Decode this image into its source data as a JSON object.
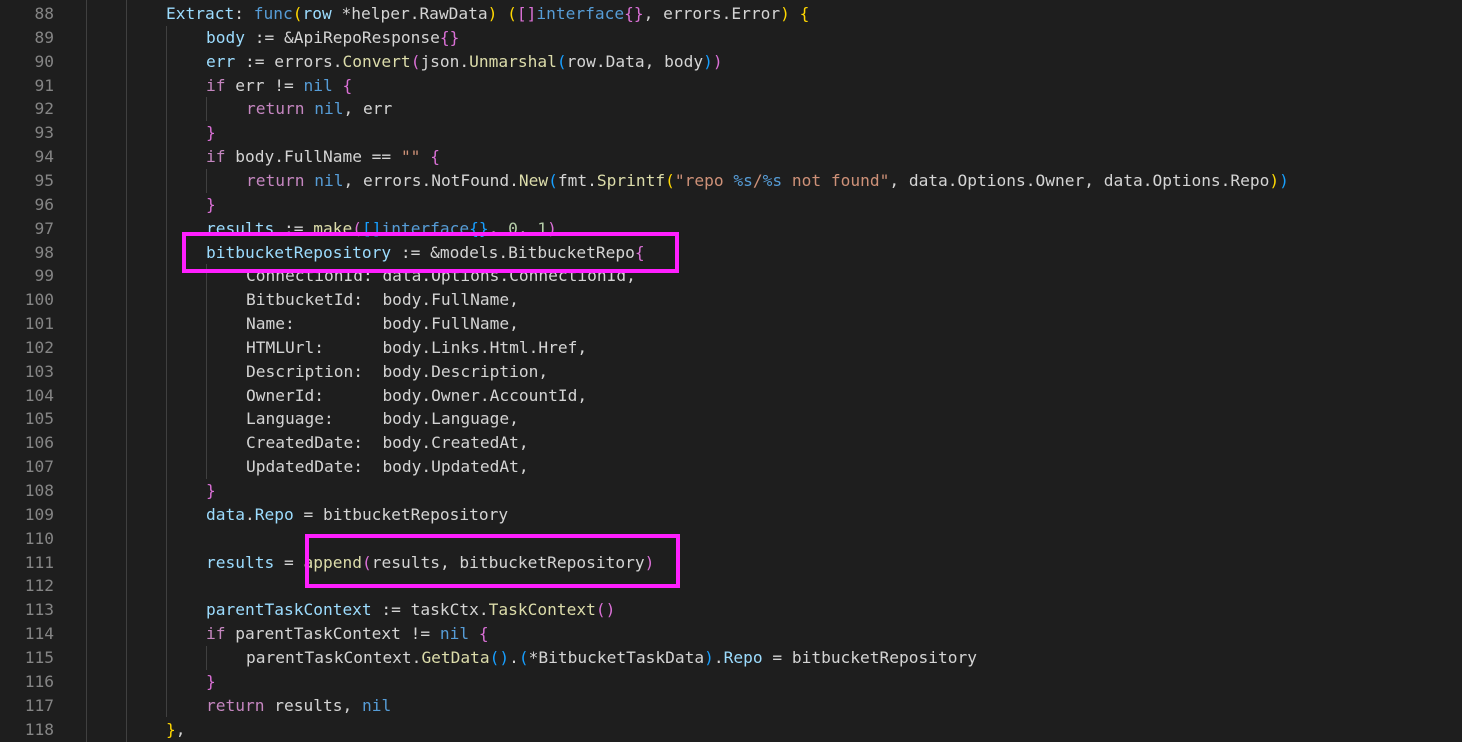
{
  "editor": {
    "language": "go",
    "colors": {
      "background": "#1e1e1e",
      "line_number": "#858585",
      "highlight": "#ff1fff"
    },
    "lines": [
      {
        "number": "88",
        "tokens": [
          [
            "tk-var",
            "Extract"
          ],
          [
            "tk-plain",
            ": "
          ],
          [
            "tk-kw",
            "func"
          ],
          [
            "tk-b1",
            "("
          ],
          [
            "tk-var",
            "row"
          ],
          [
            "tk-plain",
            " *"
          ],
          [
            "tk-plain",
            "helper.RawData"
          ],
          [
            "tk-b1",
            ")"
          ],
          [
            "tk-plain",
            " "
          ],
          [
            "tk-b1",
            "("
          ],
          [
            "tk-b2",
            "[]"
          ],
          [
            "tk-kw",
            "interface"
          ],
          [
            "tk-b2",
            "{}"
          ],
          [
            "tk-plain",
            ", errors.Error"
          ],
          [
            "tk-b1",
            ")"
          ],
          [
            "tk-plain",
            " "
          ],
          [
            "tk-b1",
            "{"
          ]
        ]
      },
      {
        "number": "89",
        "tokens": [
          [
            "tk-var",
            "body"
          ],
          [
            "tk-plain",
            " := &ApiRepoResponse"
          ],
          [
            "tk-b2",
            "{}"
          ]
        ]
      },
      {
        "number": "90",
        "tokens": [
          [
            "tk-var",
            "err"
          ],
          [
            "tk-plain",
            " := errors."
          ],
          [
            "tk-fn",
            "Convert"
          ],
          [
            "tk-b2",
            "("
          ],
          [
            "tk-plain",
            "json."
          ],
          [
            "tk-fn",
            "Unmarshal"
          ],
          [
            "tk-b3",
            "("
          ],
          [
            "tk-plain",
            "row.Data, body"
          ],
          [
            "tk-b3",
            ")"
          ],
          [
            "tk-b2",
            ")"
          ]
        ]
      },
      {
        "number": "91",
        "tokens": [
          [
            "tk-ctrl",
            "if"
          ],
          [
            "tk-plain",
            " err != "
          ],
          [
            "tk-kw",
            "nil"
          ],
          [
            "tk-plain",
            " "
          ],
          [
            "tk-b2",
            "{"
          ]
        ]
      },
      {
        "number": "92",
        "tokens": [
          [
            "tk-ctrl",
            "return"
          ],
          [
            "tk-plain",
            " "
          ],
          [
            "tk-kw",
            "nil"
          ],
          [
            "tk-plain",
            ", err"
          ]
        ]
      },
      {
        "number": "93",
        "tokens": [
          [
            "tk-b2",
            "}"
          ]
        ]
      },
      {
        "number": "94",
        "tokens": [
          [
            "tk-ctrl",
            "if"
          ],
          [
            "tk-plain",
            " body.FullName == "
          ],
          [
            "tk-str",
            "\"\""
          ],
          [
            "tk-plain",
            " "
          ],
          [
            "tk-b2",
            "{"
          ]
        ]
      },
      {
        "number": "95",
        "tokens": [
          [
            "tk-ctrl",
            "return"
          ],
          [
            "tk-plain",
            " "
          ],
          [
            "tk-kw",
            "nil"
          ],
          [
            "tk-plain",
            ", errors.NotFound."
          ],
          [
            "tk-fn",
            "New"
          ],
          [
            "tk-b3",
            "("
          ],
          [
            "tk-plain",
            "fmt."
          ],
          [
            "tk-fn",
            "Sprintf"
          ],
          [
            "tk-b1",
            "("
          ],
          [
            "tk-str",
            "\"repo "
          ],
          [
            "tk-kw",
            "%s"
          ],
          [
            "tk-str",
            "/"
          ],
          [
            "tk-kw",
            "%s"
          ],
          [
            "tk-str",
            " not found\""
          ],
          [
            "tk-plain",
            ", data.Options.Owner, data.Options.Repo"
          ],
          [
            "tk-b1",
            ")"
          ],
          [
            "tk-b3",
            ")"
          ]
        ]
      },
      {
        "number": "96",
        "tokens": [
          [
            "tk-b2",
            "}"
          ]
        ]
      },
      {
        "number": "97",
        "tokens": [
          [
            "tk-var",
            "results"
          ],
          [
            "tk-plain",
            " := "
          ],
          [
            "tk-fn",
            "make"
          ],
          [
            "tk-b2",
            "("
          ],
          [
            "tk-b3",
            "[]"
          ],
          [
            "tk-kw",
            "interface"
          ],
          [
            "tk-b3",
            "{}"
          ],
          [
            "tk-plain",
            ", "
          ],
          [
            "tk-num",
            "0"
          ],
          [
            "tk-plain",
            ", "
          ],
          [
            "tk-num",
            "1"
          ],
          [
            "tk-b2",
            ")"
          ]
        ]
      },
      {
        "number": "98",
        "tokens": [
          [
            "tk-var",
            "bitbucketRepository"
          ],
          [
            "tk-plain",
            " := &models.BitbucketRepo"
          ],
          [
            "tk-b2",
            "{"
          ]
        ]
      },
      {
        "number": "99",
        "tokens": [
          [
            "tk-plain",
            "ConnectionId: data.Options.ConnectionId,"
          ]
        ]
      },
      {
        "number": "100",
        "tokens": [
          [
            "tk-plain",
            "BitbucketId:  body.FullName,"
          ]
        ]
      },
      {
        "number": "101",
        "tokens": [
          [
            "tk-plain",
            "Name:         body.FullName,"
          ]
        ]
      },
      {
        "number": "102",
        "tokens": [
          [
            "tk-plain",
            "HTMLUrl:      body.Links.Html.Href,"
          ]
        ]
      },
      {
        "number": "103",
        "tokens": [
          [
            "tk-plain",
            "Description:  body.Description,"
          ]
        ]
      },
      {
        "number": "104",
        "tokens": [
          [
            "tk-plain",
            "OwnerId:      body.Owner.AccountId,"
          ]
        ]
      },
      {
        "number": "105",
        "tokens": [
          [
            "tk-plain",
            "Language:     body.Language,"
          ]
        ]
      },
      {
        "number": "106",
        "tokens": [
          [
            "tk-plain",
            "CreatedDate:  body.CreatedAt,"
          ]
        ]
      },
      {
        "number": "107",
        "tokens": [
          [
            "tk-plain",
            "UpdatedDate:  body.UpdatedAt,"
          ]
        ]
      },
      {
        "number": "108",
        "tokens": [
          [
            "tk-b2",
            "}"
          ]
        ]
      },
      {
        "number": "109",
        "tokens": [
          [
            "tk-var",
            "data"
          ],
          [
            "tk-plain",
            "."
          ],
          [
            "tk-var",
            "Repo"
          ],
          [
            "tk-plain",
            " = bitbucketRepository"
          ]
        ]
      },
      {
        "number": "110",
        "tokens": []
      },
      {
        "number": "111",
        "tokens": [
          [
            "tk-var",
            "results"
          ],
          [
            "tk-plain",
            " = "
          ],
          [
            "tk-fn",
            "append"
          ],
          [
            "tk-b2",
            "("
          ],
          [
            "tk-plain",
            "results, bitbucketRepository"
          ],
          [
            "tk-b2",
            ")"
          ]
        ]
      },
      {
        "number": "112",
        "tokens": []
      },
      {
        "number": "113",
        "tokens": [
          [
            "tk-var",
            "parentTaskContext"
          ],
          [
            "tk-plain",
            " := taskCtx."
          ],
          [
            "tk-fn",
            "TaskContext"
          ],
          [
            "tk-b2",
            "()"
          ]
        ]
      },
      {
        "number": "114",
        "tokens": [
          [
            "tk-ctrl",
            "if"
          ],
          [
            "tk-plain",
            " parentTaskContext != "
          ],
          [
            "tk-kw",
            "nil"
          ],
          [
            "tk-plain",
            " "
          ],
          [
            "tk-b2",
            "{"
          ]
        ]
      },
      {
        "number": "115",
        "tokens": [
          [
            "tk-plain",
            "parentTaskContext."
          ],
          [
            "tk-fn",
            "GetData"
          ],
          [
            "tk-b3",
            "()"
          ],
          [
            "tk-plain",
            "."
          ],
          [
            "tk-b3",
            "("
          ],
          [
            "tk-plain",
            "*BitbucketTaskData"
          ],
          [
            "tk-b3",
            ")"
          ],
          [
            "tk-plain",
            "."
          ],
          [
            "tk-var",
            "Repo"
          ],
          [
            "tk-plain",
            " = bitbucketRepository"
          ]
        ]
      },
      {
        "number": "116",
        "tokens": [
          [
            "tk-b2",
            "}"
          ]
        ]
      },
      {
        "number": "117",
        "tokens": [
          [
            "tk-ctrl",
            "return"
          ],
          [
            "tk-plain",
            " results, "
          ],
          [
            "tk-kw",
            "nil"
          ]
        ]
      },
      {
        "number": "118",
        "tokens": [
          [
            "tk-b1",
            "}"
          ],
          [
            "tk-plain",
            ","
          ]
        ]
      }
    ]
  }
}
